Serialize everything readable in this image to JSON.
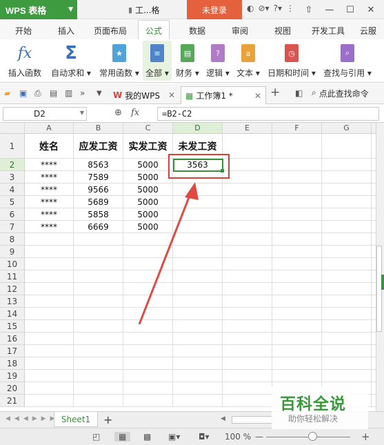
{
  "window": {
    "app_title": "WPS 表格",
    "doc_short": "工...格",
    "login_label": "未登录",
    "help": "?",
    "ctrl_min": "—",
    "ctrl_max": "☐",
    "ctrl_close": "✕"
  },
  "menu": {
    "items": [
      "开始",
      "插入",
      "页面布局",
      "公式",
      "数据",
      "审阅",
      "视图",
      "开发工具",
      "云服"
    ],
    "active": "公式"
  },
  "ribbon": {
    "buttons": [
      {
        "label": "插入函数",
        "icon": "fx-icon"
      },
      {
        "label": "自动求和",
        "icon": "sigma-icon"
      },
      {
        "label": "常用函数",
        "icon": "star-book-icon"
      },
      {
        "label": "全部",
        "icon": "book-icon"
      },
      {
        "label": "财务",
        "icon": "finance-icon"
      },
      {
        "label": "逻辑",
        "icon": "question-icon"
      },
      {
        "label": "文本",
        "icon": "text-a-icon"
      },
      {
        "label": "日期和时间",
        "icon": "clock-icon"
      },
      {
        "label": "查找与引用",
        "icon": "search-doc-icon"
      }
    ]
  },
  "tabs": {
    "my_wps": "我的WPS",
    "workbook": "工作簿1 *",
    "search_cmd": "点此查找命令"
  },
  "formula_bar": {
    "name_box": "D2",
    "fx": "fx",
    "formula": "=B2-C2"
  },
  "sheet": {
    "columns": [
      "A",
      "B",
      "C",
      "D",
      "E",
      "F",
      "G"
    ],
    "rows": [
      "1",
      "2",
      "3",
      "4",
      "5",
      "6",
      "7",
      "8",
      "9",
      "10",
      "11",
      "12",
      "13",
      "14",
      "15",
      "16",
      "17",
      "18",
      "19",
      "20",
      "21"
    ],
    "header": [
      "姓名",
      "应发工资",
      "实发工资",
      "未发工资"
    ],
    "data": [
      [
        "****",
        "8563",
        "5000",
        "3563"
      ],
      [
        "****",
        "7589",
        "5000",
        ""
      ],
      [
        "****",
        "9566",
        "5000",
        ""
      ],
      [
        "****",
        "5689",
        "5000",
        ""
      ],
      [
        "****",
        "5858",
        "5000",
        ""
      ],
      [
        "****",
        "6669",
        "5000",
        ""
      ]
    ],
    "selected_cell": "D2"
  },
  "sheet_tabs": {
    "name": "Sheet1",
    "add": "+"
  },
  "status": {
    "zoom": "100 %",
    "minus": "—",
    "plus": "+"
  },
  "watermark": {
    "title": "百科全说",
    "subtitle": "助你轻松解决"
  },
  "colors": {
    "accent_green": "#3f9b3f",
    "login_orange": "#e5603c",
    "highlight_red": "#d9403a"
  }
}
